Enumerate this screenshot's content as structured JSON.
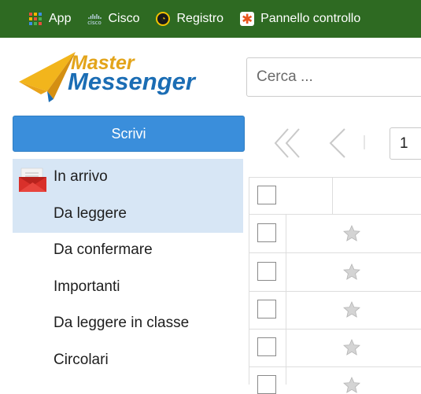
{
  "bookmarks": [
    {
      "label": "App",
      "icon": "apps-grid-icon"
    },
    {
      "label": "Cisco",
      "icon": "cisco-icon",
      "icon_text": "cisco"
    },
    {
      "label": "Registro",
      "icon": "registro-icon"
    },
    {
      "label": "Pannello controllo",
      "icon": "pannello-icon"
    }
  ],
  "logo": {
    "line1": "Master",
    "line2": "Messenger"
  },
  "search": {
    "placeholder": "Cerca ..."
  },
  "compose": {
    "label": "Scrivi"
  },
  "folders": [
    {
      "label": "In arrivo",
      "icon": "envelope-icon",
      "selected": true
    },
    {
      "label": "Da leggere",
      "selected": true
    },
    {
      "label": "Da confermare"
    },
    {
      "label": "Importanti"
    },
    {
      "label": "Da leggere in classe"
    },
    {
      "label": "Circolari"
    }
  ],
  "pagination": {
    "page": "1"
  },
  "colors": {
    "bookmarks_bar": "#2e6a22",
    "accent": "#3a8edb",
    "selection": "#d7e6f5",
    "logo_orange": "#e3a41a",
    "logo_blue": "#1b6db4"
  }
}
